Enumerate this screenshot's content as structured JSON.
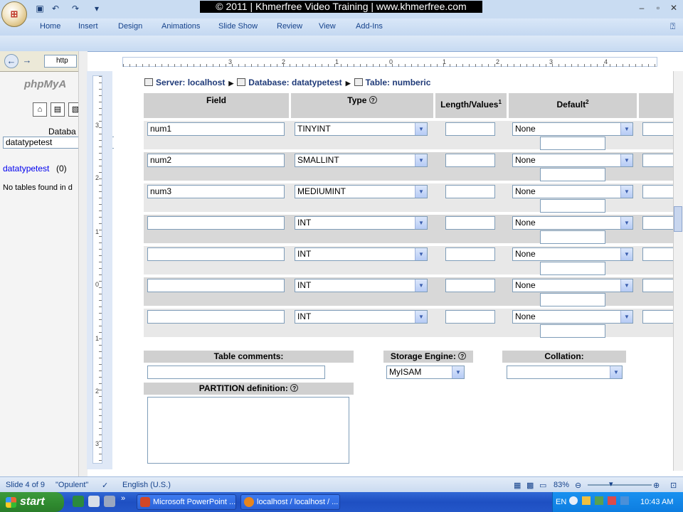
{
  "watermark": "© 2011 | Khmerfree Video Training | www.khmerfree.com",
  "ribbon_tabs": [
    "Home",
    "Insert",
    "Design",
    "Animations",
    "Slide Show",
    "Review",
    "View",
    "Add-Ins"
  ],
  "browser": {
    "address_fragment": "http"
  },
  "sidebar": {
    "logo_text": "phpMyA",
    "database_label": "Databa",
    "database_selected": "datatypetest",
    "db_link": "datatypetest",
    "db_count": "(0)",
    "no_tables": "No tables found in d"
  },
  "ruler": {
    "h_labels": [
      "3",
      "2",
      "1",
      "0",
      "1",
      "2",
      "3",
      "4"
    ],
    "v_labels": [
      "3",
      "2",
      "1",
      "0",
      "1",
      "2",
      "3"
    ]
  },
  "breadcrumb": {
    "server": "Server: localhost",
    "database": "Database: datatypetest",
    "table": "Table: numberic"
  },
  "table_headers": {
    "field": "Field",
    "type": "Type",
    "length": "Length/Values",
    "length_sup": "1",
    "default": "Default",
    "default_sup": "2"
  },
  "rows": [
    {
      "field": "num1",
      "type": "TINYINT",
      "length": "",
      "default": "None"
    },
    {
      "field": "num2",
      "type": "SMALLINT",
      "length": "",
      "default": "None"
    },
    {
      "field": "num3",
      "type": "MEDIUMINT",
      "length": "",
      "default": "None"
    },
    {
      "field": "",
      "type": "INT",
      "length": "",
      "default": "None"
    },
    {
      "field": "",
      "type": "INT",
      "length": "",
      "default": "None"
    },
    {
      "field": "",
      "type": "INT",
      "length": "",
      "default": "None"
    },
    {
      "field": "",
      "type": "INT",
      "length": "",
      "default": "None"
    }
  ],
  "bottom": {
    "table_comments_label": "Table comments:",
    "table_comments_value": "",
    "storage_engine_label": "Storage Engine:",
    "storage_engine_value": "MyISAM",
    "collation_label": "Collation:",
    "collation_value": "",
    "partition_label": "PARTITION definition:"
  },
  "status": {
    "slide": "Slide 4 of 9",
    "theme": "\"Opulent\"",
    "language": "English (U.S.)",
    "zoom": "83%"
  },
  "taskbar": {
    "start": "start",
    "task1": "Microsoft PowerPoint ...",
    "task2": "localhost / localhost / ...",
    "lang": "EN",
    "clock": "10:43 AM"
  }
}
